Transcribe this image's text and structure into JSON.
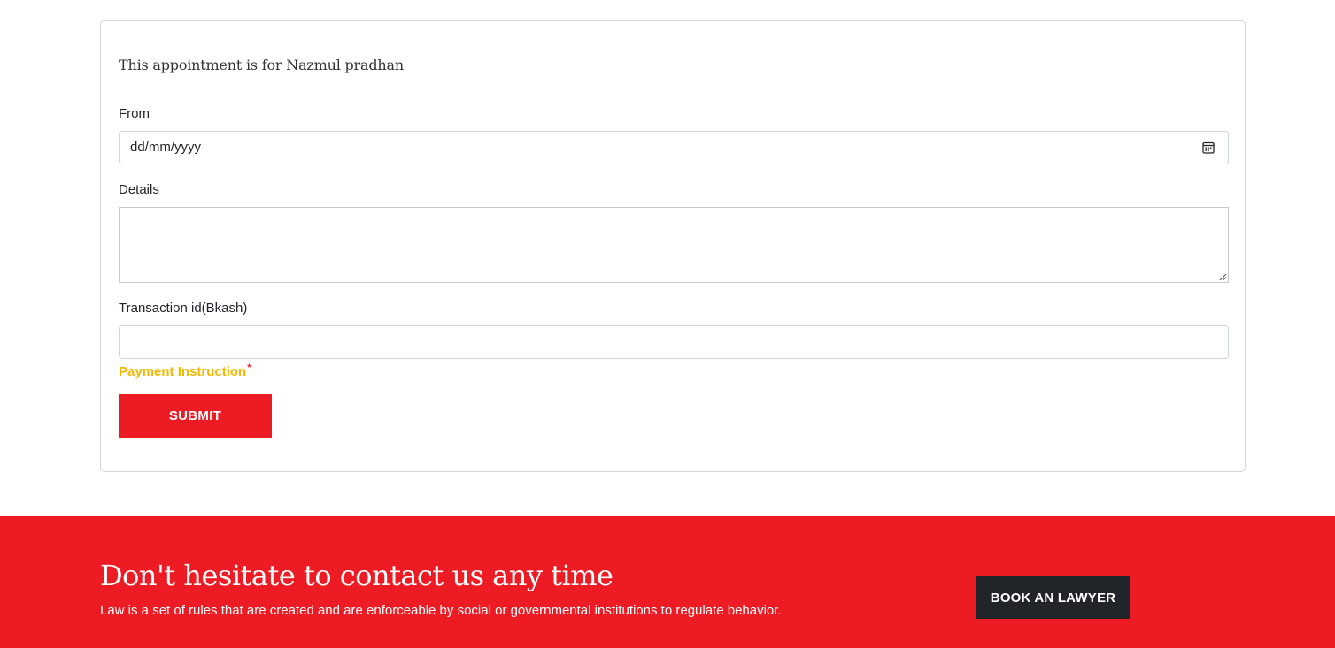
{
  "form": {
    "title": "This appointment is for Nazmul pradhan",
    "from_label": "From",
    "from_value": "dd/mm/yyyy",
    "details_label": "Details",
    "details_value": "",
    "transaction_label": "Transaction id(Bkash)",
    "transaction_value": "",
    "payment_link": "Payment Instruction",
    "required_mark": "*",
    "submit_label": "SUBMIT",
    "calendar_icon": "calendar-icon",
    "resize_icon": "resize-handle-icon"
  },
  "footer": {
    "title": "Don't hesitate to contact us any time",
    "subtitle": "Law is a set of rules that are created and are enforceable by social or governmental institutions to regulate behavior.",
    "book_button": "BOOK AN LAWYER"
  },
  "colors": {
    "accent_red": "#ed1c24",
    "link_yellow": "#f5b800",
    "dark_button": "#212529"
  }
}
